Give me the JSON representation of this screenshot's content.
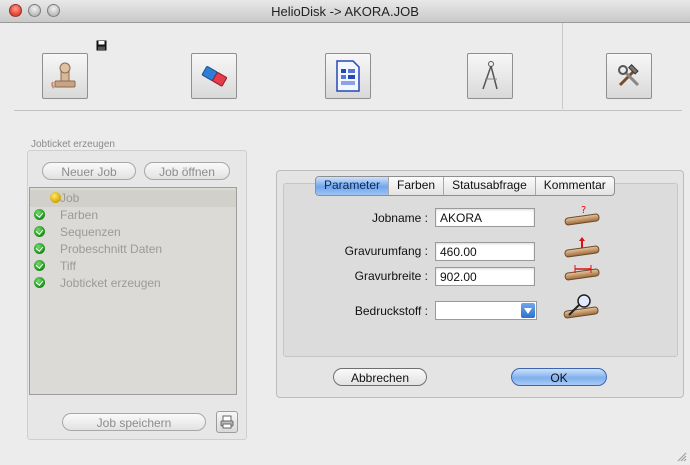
{
  "window": {
    "title": "HelioDisk -> AKORA.JOB"
  },
  "left": {
    "group_label": "Jobticket erzeugen",
    "new_job": "Neuer Job",
    "open_job": "Job öffnen",
    "save_job": "Job speichern",
    "items": [
      {
        "label": "Job",
        "icon": "smiley-icon"
      },
      {
        "label": "Farben",
        "icon": "check-icon"
      },
      {
        "label": "Sequenzen",
        "icon": "check-icon"
      },
      {
        "label": "Probeschnitt Daten",
        "icon": "check-icon"
      },
      {
        "label": "Tiff",
        "icon": "check-icon"
      },
      {
        "label": "Jobticket erzeugen",
        "icon": "check-icon"
      }
    ]
  },
  "tabs": [
    "Parameter",
    "Farben",
    "Statusabfrage",
    "Kommentar"
  ],
  "form": {
    "jobname_label": "Jobname :",
    "jobname_value": "AKORA",
    "gravurumfang_label": "Gravurumfang :",
    "gravurumfang_value": "460.00",
    "gravurbreite_label": "Gravurbreite :",
    "gravurbreite_value": "902.00",
    "bedruckstoff_label": "Bedruckstoff :",
    "bedruckstoff_value": ""
  },
  "buttons": {
    "cancel": "Abbrechen",
    "ok": "OK"
  },
  "colors": {
    "accent": "#70a6ec",
    "ok_green": "#1a8a16"
  }
}
